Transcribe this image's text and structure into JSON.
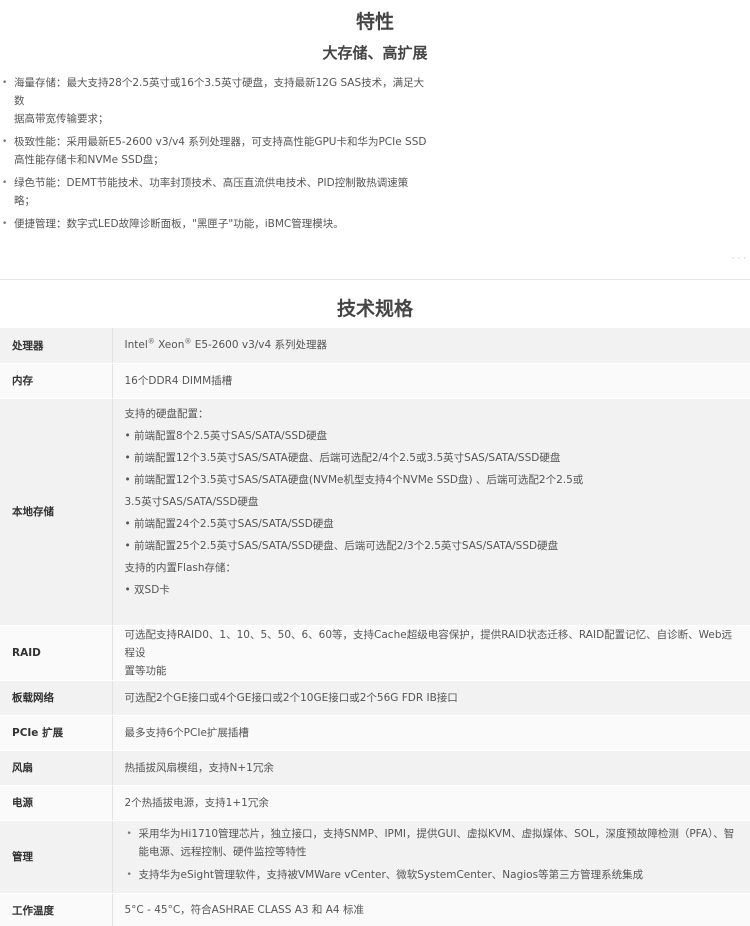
{
  "features": {
    "title": "特性",
    "subtitle": "大存储、高扩展",
    "items": [
      [
        "海量存储：最大支持28个2.5英寸或16个3.5英寸硬盘，支持最新12G SAS技术，满足大数",
        "据高带宽传输要求；"
      ],
      [
        "极致性能：采用最新E5-2600 v3/v4 系列处理器，可支持高性能GPU卡和华为PCIe SSD",
        "高性能存储卡和NVMe SSD盘；"
      ],
      [
        "绿色节能：DEMT节能技术、功率封顶技术、高压直流供电技术、PID控制散热调速策",
        "略；"
      ],
      [
        "便捷管理：数字式LED故障诊断面板，\"黑匣子\"功能，iBMC管理模块。"
      ]
    ]
  },
  "specs": {
    "title": "技术规格",
    "processor": {
      "label": "处理器",
      "pre": "Intel",
      "mid": " Xeon",
      "post": " E5-2600 v3/v4 系列处理器",
      "reg": "®"
    },
    "memory": {
      "label": "内存",
      "value": "16个DDR4 DIMM插槽"
    },
    "storage": {
      "label": "本地存储",
      "lines": [
        "支持的硬盘配置：",
        "• 前端配置8个2.5英寸SAS/SATA/SSD硬盘",
        "• 前端配置12个3.5英寸SAS/SATA硬盘、后端可选配2/4个2.5或3.5英寸SAS/SATA/SSD硬盘",
        "• 前端配置12个3.5英寸SAS/SATA硬盘(NVMe机型支持4个NVMe SSD盘) 、后端可选配2个2.5或",
        "3.5英寸SAS/SATA/SSD硬盘",
        "• 前端配置24个2.5英寸SAS/SATA/SSD硬盘",
        "• 前端配置25个2.5英寸SAS/SATA/SSD硬盘、后端可选配2/3个2.5英寸SAS/SATA/SSD硬盘",
        "支持的内置Flash存储：",
        "• 双SD卡"
      ]
    },
    "raid": {
      "label": "RAID",
      "line1": "可选配支持RAID0、1、10、5、50、6、60等，支持Cache超级电容保护，提供RAID状态迁移、RAID配置记忆、自诊断、Web远程设",
      "line2": "置等功能"
    },
    "network": {
      "label": "板载网络",
      "value": "可选配2个GE接口或4个GE接口或2个10GE接口或2个56G FDR IB接口"
    },
    "pcie": {
      "label": "PCIe 扩展",
      "value": "最多支持6个PCIe扩展插槽"
    },
    "fan": {
      "label": "风扇",
      "value": "热插拔风扇模组，支持N+1冗余"
    },
    "power": {
      "label": "电源",
      "value": "2个热插拔电源，支持1+1冗余"
    },
    "management": {
      "label": "管理",
      "items": [
        [
          "采用华为Hi1710管理芯片，独立接口，支持SNMP、IPMI，提供GUI、虚拟KVM、虚拟媒体、SOL，深度预故障检测（PFA）、智",
          "能电源、远程控制、硬件监控等特性"
        ],
        [
          "支持华为eSight管理软件，支持被VMWare vCenter、微软SystemCenter、Nagios等第三方管理系统集成"
        ]
      ]
    },
    "temperature": {
      "label": "工作温度",
      "value": "5°C - 45°C，符合ASHRAE CLASS A3 和 A4 标准"
    }
  }
}
